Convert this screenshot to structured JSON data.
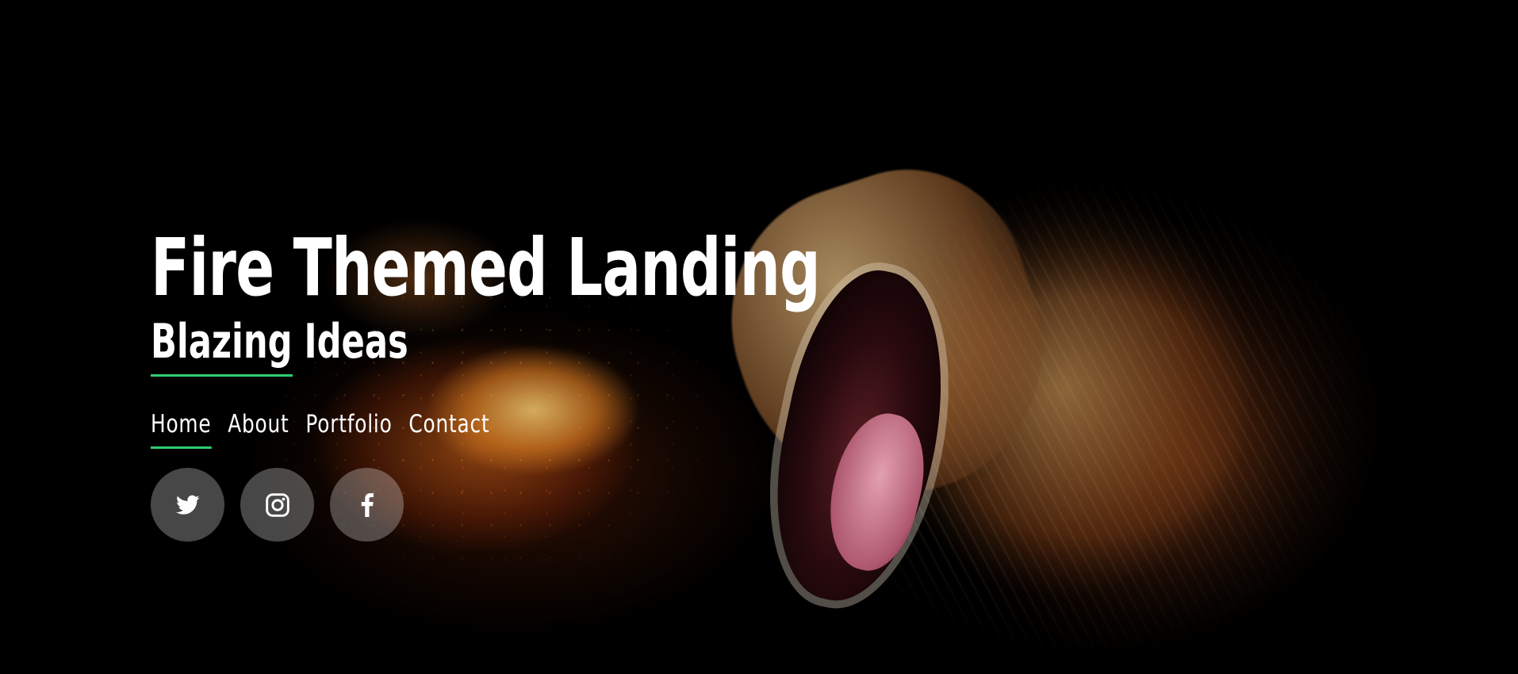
{
  "hero": {
    "title": "Fire Themed Landing",
    "subtitle": "Blazing Ideas"
  },
  "nav": {
    "items": [
      {
        "label": "Home",
        "active": true
      },
      {
        "label": "About",
        "active": false
      },
      {
        "label": "Portfolio",
        "active": false
      },
      {
        "label": "Contact",
        "active": false
      }
    ]
  },
  "social": [
    {
      "icon": "twitter-icon"
    },
    {
      "icon": "instagram-icon"
    },
    {
      "icon": "facebook-icon"
    }
  ],
  "colors": {
    "accent": "#2ecc71",
    "text": "#ffffff",
    "background": "#000000",
    "social_bg": "rgba(255,255,255,0.28)"
  }
}
